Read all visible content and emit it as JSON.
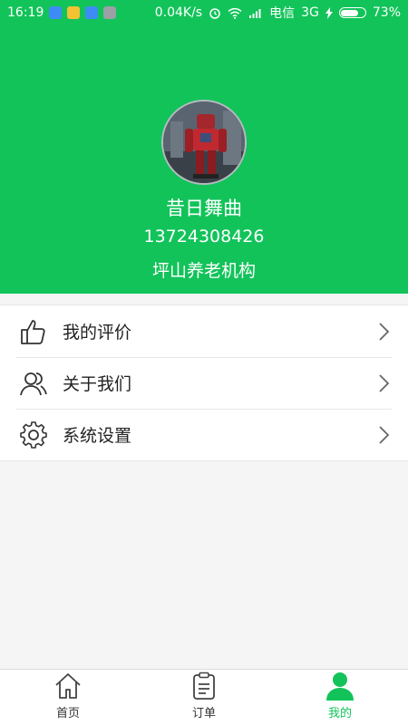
{
  "status_bar": {
    "time": "16:19",
    "net_speed": "0.04K/s",
    "carrier": "电信",
    "network": "3G",
    "battery": "73%",
    "battery_level": 0.73
  },
  "profile": {
    "name": "昔日舞曲",
    "phone": "13724308426",
    "org": "坪山养老机构"
  },
  "menu": {
    "items": [
      {
        "label": "我的评价",
        "icon": "thumbs-up-icon"
      },
      {
        "label": "关于我们",
        "icon": "people-icon"
      },
      {
        "label": "系统设置",
        "icon": "gear-icon"
      }
    ]
  },
  "tabs": [
    {
      "label": "首页",
      "icon": "home-icon",
      "active": false
    },
    {
      "label": "订单",
      "icon": "order-icon",
      "active": false
    },
    {
      "label": "我的",
      "icon": "user-icon",
      "active": true
    }
  ],
  "colors": {
    "accent": "#12c35a",
    "background": "#f5f5f5"
  }
}
